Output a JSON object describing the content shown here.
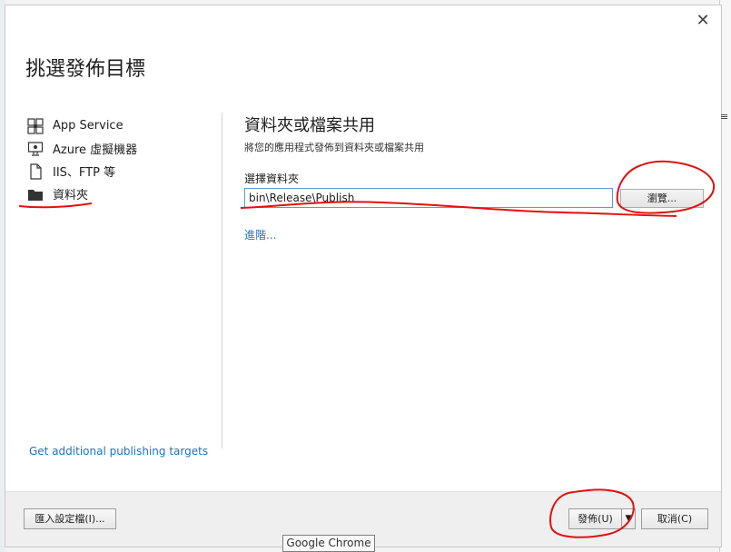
{
  "dialog": {
    "title": "挑選發佈目標",
    "close_icon": "close-icon"
  },
  "nav": {
    "items": [
      {
        "label": "App Service",
        "icon": "app-service-icon"
      },
      {
        "label": "Azure 虛擬機器",
        "icon": "virtual-machine-icon"
      },
      {
        "label": "IIS、FTP 等",
        "icon": "iis-ftp-icon"
      },
      {
        "label": "資料夾",
        "icon": "folder-icon"
      }
    ],
    "selected": "資料夾"
  },
  "panel": {
    "heading": "資料夾或檔案共用",
    "subtitle": "將您的應用程式發佈到資料夾或檔案共用",
    "folder_label": "選擇資料夾",
    "folder_value": "bin\\Release\\Publish",
    "browse_label": "瀏覽...",
    "advanced_link": "進階..."
  },
  "additional_link": "Get additional publishing targets",
  "footer": {
    "import_label": "匯入設定檔(I)...",
    "publish_label": "發佈(U)",
    "publish_dropdown_icon": "chevron-down-icon",
    "cancel_label": "取消(C)"
  },
  "taskbar": {
    "tooltip": "Google Chrome"
  },
  "colors": {
    "link": "#1a73c5",
    "annotation": "#e01010",
    "input_border": "#5b9ad4"
  }
}
